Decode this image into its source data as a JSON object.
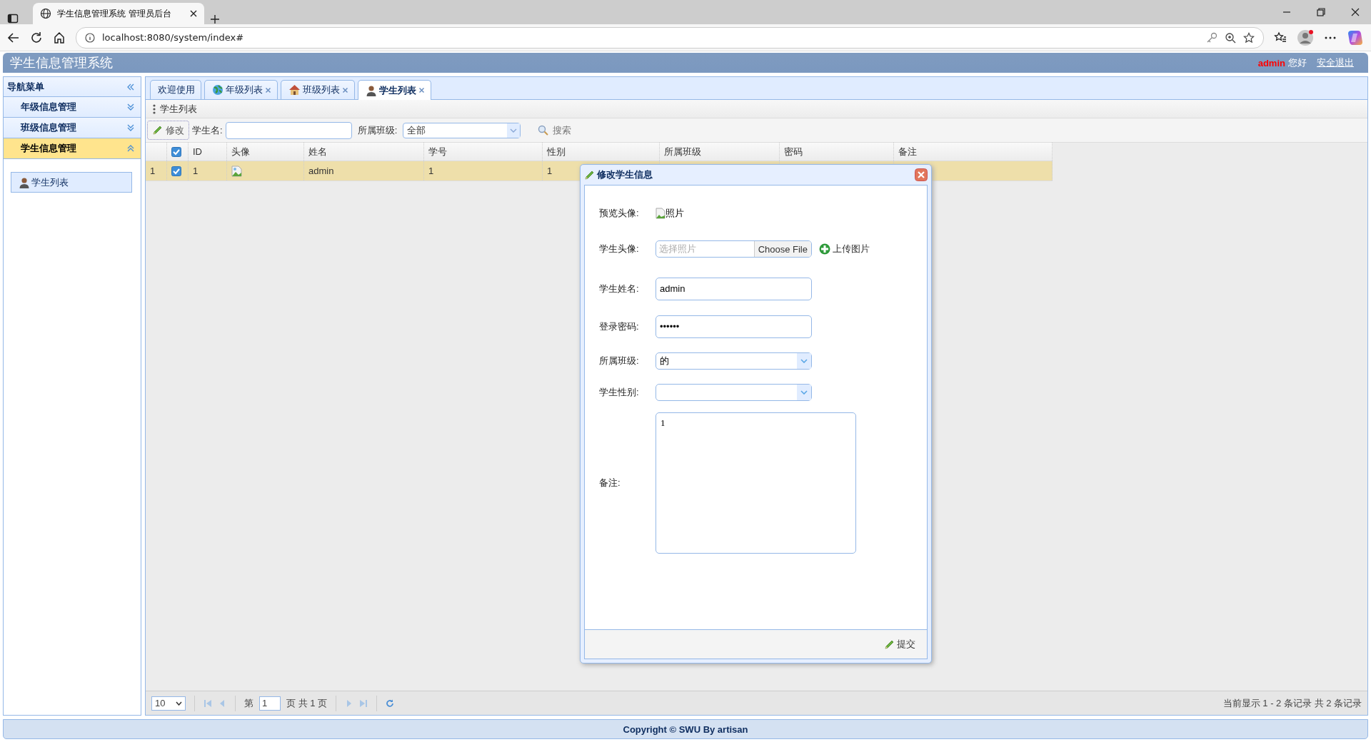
{
  "browser": {
    "tab_title": "学生信息管理系统 管理员后台",
    "url": "localhost:8080/system/index#"
  },
  "header": {
    "title": "学生信息管理系统",
    "user": "admin",
    "greeting": "您好",
    "logout": "安全退出"
  },
  "nav": {
    "title": "导航菜单",
    "sections": [
      {
        "label": "年级信息管理",
        "expanded": false
      },
      {
        "label": "班级信息管理",
        "expanded": false
      },
      {
        "label": "学生信息管理",
        "expanded": true,
        "children": [
          {
            "label": "学生列表"
          }
        ]
      }
    ]
  },
  "tabs": [
    {
      "label": "欢迎使用",
      "selected": false,
      "closable": false
    },
    {
      "label": "年级列表",
      "selected": false,
      "closable": true
    },
    {
      "label": "班级列表",
      "selected": false,
      "closable": true
    },
    {
      "label": "学生列表",
      "selected": true,
      "closable": true
    }
  ],
  "panel_title": "学生列表",
  "toolbar": {
    "edit_button": "修改",
    "name_label": "学生名:",
    "class_label": "所属班级:",
    "class_value": "全部",
    "search_button": "搜索"
  },
  "table": {
    "header_checked": true,
    "columns": [
      "ID",
      "头像",
      "姓名",
      "学号",
      "性别",
      "所属班级",
      "密码",
      "备注"
    ],
    "rows": [
      {
        "number": "1",
        "checked": true,
        "selected": true,
        "cells": [
          {
            "kind": "text",
            "text": "1"
          },
          {
            "kind": "image"
          },
          {
            "kind": "text",
            "text": "admin"
          },
          {
            "kind": "text",
            "text": "1"
          },
          {
            "kind": "text",
            "text": "1"
          }
        ]
      }
    ]
  },
  "pager": {
    "page_size": "10",
    "page_prefix": "第",
    "page": "1",
    "page_suffix": "页 共 1 页",
    "summary": "当前显示 1 - 2 条记录 共 2 条记录"
  },
  "dialog": {
    "title": "修改学生信息",
    "submit": "提交",
    "fields": [
      {
        "kind": "image",
        "label": "预览头像:",
        "alt": "照片"
      },
      {
        "kind": "file",
        "label": "学生头像:",
        "placeholder": "选择照片",
        "button": "Choose File",
        "upload": "上传图片"
      },
      {
        "kind": "text",
        "label": "学生姓名:",
        "value": "admin"
      },
      {
        "kind": "text",
        "label": "登录密码:",
        "value": "••••••"
      },
      {
        "kind": "select",
        "label": "所属班级:",
        "value": "的"
      },
      {
        "kind": "select",
        "label": "学生性别:"
      },
      {
        "kind": "textarea",
        "label": "备注:",
        "value": "1"
      }
    ]
  },
  "footer": "Copyright © SWU By artisan"
}
